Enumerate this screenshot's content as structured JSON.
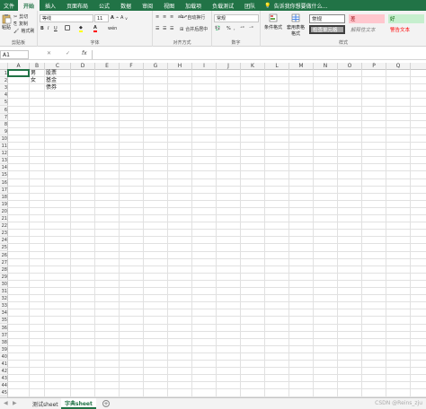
{
  "ribbon_tabs": {
    "file": "文件",
    "tabs": [
      "开始",
      "插入",
      "页面布局",
      "公式",
      "数据",
      "审阅",
      "视图",
      "加载项",
      "负载测试",
      "团队"
    ],
    "active_index": 0,
    "tell_me": "告诉我你想要做什么..."
  },
  "clipboard": {
    "paste": "粘贴",
    "cut": "剪切",
    "copy": "复制",
    "format_painter": "格式刷",
    "label": "剪贴板"
  },
  "font": {
    "family": "等线",
    "size": "11",
    "grow": "A",
    "shrink": "A",
    "bold": "B",
    "italic": "I",
    "underline": "U",
    "phonetic": "wén",
    "label": "字体"
  },
  "alignment": {
    "wrap_text": "自动换行",
    "merge_center": "合并后居中",
    "label": "对齐方式"
  },
  "number": {
    "format": "常规",
    "percent": "%",
    "label": "数字"
  },
  "styles": {
    "conditional": "条件格式",
    "table": "套用表格格式",
    "normal": "常规",
    "bad": "差",
    "good": "好",
    "check_cell": "检查单元格",
    "explanatory": "解释性文本",
    "warning": "警告文本",
    "label": "样式"
  },
  "formula_bar": {
    "name_box": "A1",
    "cancel": "✕",
    "enter": "✓",
    "fx": "fx",
    "content": ""
  },
  "columns": [
    "A",
    "B",
    "C",
    "D",
    "E",
    "F",
    "G",
    "H",
    "I",
    "J",
    "K",
    "L",
    "M",
    "N",
    "O",
    "P",
    "Q"
  ],
  "rows": [
    "1",
    "2",
    "3",
    "4",
    "5",
    "6",
    "7",
    "8",
    "9",
    "10",
    "11",
    "12",
    "13",
    "14",
    "15",
    "16",
    "17",
    "18",
    "19",
    "20",
    "21",
    "22",
    "23",
    "24",
    "25",
    "26",
    "27",
    "28",
    "29",
    "30",
    "31",
    "32",
    "33",
    "34",
    "35",
    "36",
    "37",
    "38",
    "39",
    "40",
    "41",
    "42",
    "43",
    "44",
    "45"
  ],
  "cells": {
    "B1": "男",
    "B2": "女",
    "C1": "股票",
    "C2": "基金",
    "C3": "债券"
  },
  "sheets": {
    "tabs": [
      "测试sheet",
      "字典sheet"
    ],
    "active_index": 1,
    "add": "+"
  },
  "watermark": "CSDN @Reins_zju",
  "colors": {
    "accent": "#217346",
    "bad_bg": "#ffc7ce",
    "bad_fg": "#9c0006",
    "good_bg": "#c6efce",
    "good_fg": "#006100",
    "check_bg": "#a5a5a5",
    "warning_fg": "#ff0000"
  }
}
